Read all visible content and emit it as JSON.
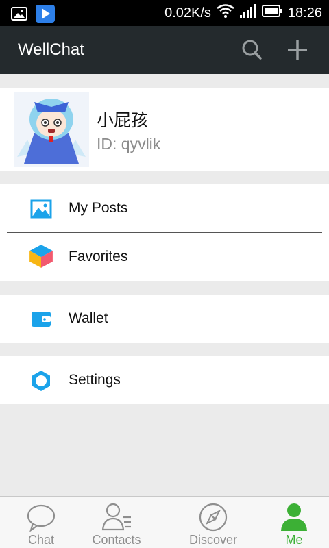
{
  "status_bar": {
    "speed": "0.02K/s",
    "time": "18:26"
  },
  "app_bar": {
    "title": "WellChat"
  },
  "profile": {
    "name": "小屁孩",
    "id": "ID: qyvlik"
  },
  "menu": {
    "posts": "My Posts",
    "favorites": "Favorites",
    "wallet": "Wallet",
    "settings": "Settings"
  },
  "nav": {
    "chat": "Chat",
    "contacts": "Contacts",
    "discover": "Discover",
    "me": "Me"
  },
  "colors": {
    "accent_green": "#3cb035",
    "icon_blue": "#1ba3ea",
    "app_bar": "#242a2d"
  }
}
